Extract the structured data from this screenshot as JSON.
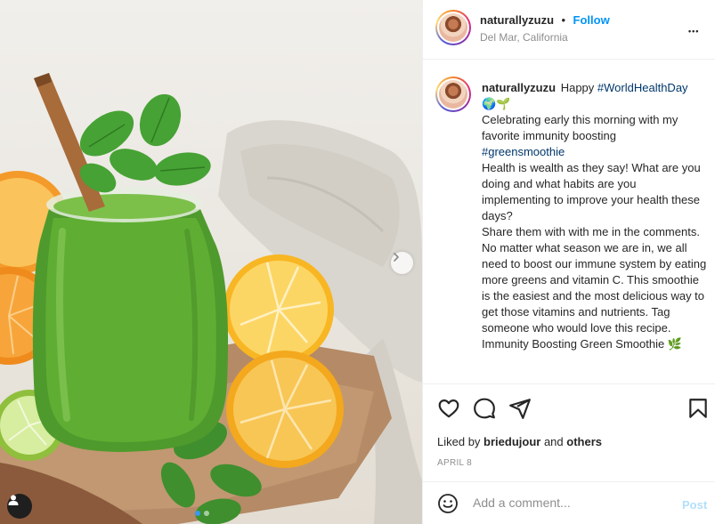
{
  "post": {
    "username": "naturallyzuzu",
    "follow_label": "Follow",
    "bullet": "•",
    "location": "Del Mar, California",
    "more_label": "•••"
  },
  "caption": {
    "username": "naturallyzuzu",
    "intro": "Happy",
    "hashtag1": "#WorldHealthDay",
    "emoji_line": "🌍🌱",
    "line1": "Celebrating early this morning with my favorite immunity boosting",
    "hashtag2": "#greensmoothie",
    "para1": "Health is wealth as they say! What are you doing and what habits are you implementing to improve your health these days?",
    "para2": "Share them with with me in the comments.",
    "para3": "No matter what season we are in, we all need to boost our immune system by eating more greens and vitamin C. This smoothie is the easiest and the most delicious way to get those vitamins and nutrients. Tag someone who would love this recipe.",
    "para4": "Immunity Boosting Green Smoothie 🌿"
  },
  "actions": {
    "like_icon": "heart-icon",
    "comment_icon": "comment-icon",
    "share_icon": "share-icon",
    "save_icon": "bookmark-icon"
  },
  "likes": {
    "prefix": "Liked by",
    "user": "briedujour",
    "and": "and",
    "others": "others"
  },
  "date": "APRIL 8",
  "comment": {
    "placeholder": "Add a comment...",
    "post_label": "Post",
    "emoji_icon": "smiley-icon"
  },
  "carousel": {
    "slide_count": 2,
    "active_slide": 1,
    "next_icon": "chevron-right-icon",
    "tag_icon": "user-tag-icon"
  },
  "colors": {
    "accent": "#0095f6",
    "hashtag": "#00376b",
    "muted": "#8e8e8e",
    "post_disabled": "#b2dffc"
  }
}
